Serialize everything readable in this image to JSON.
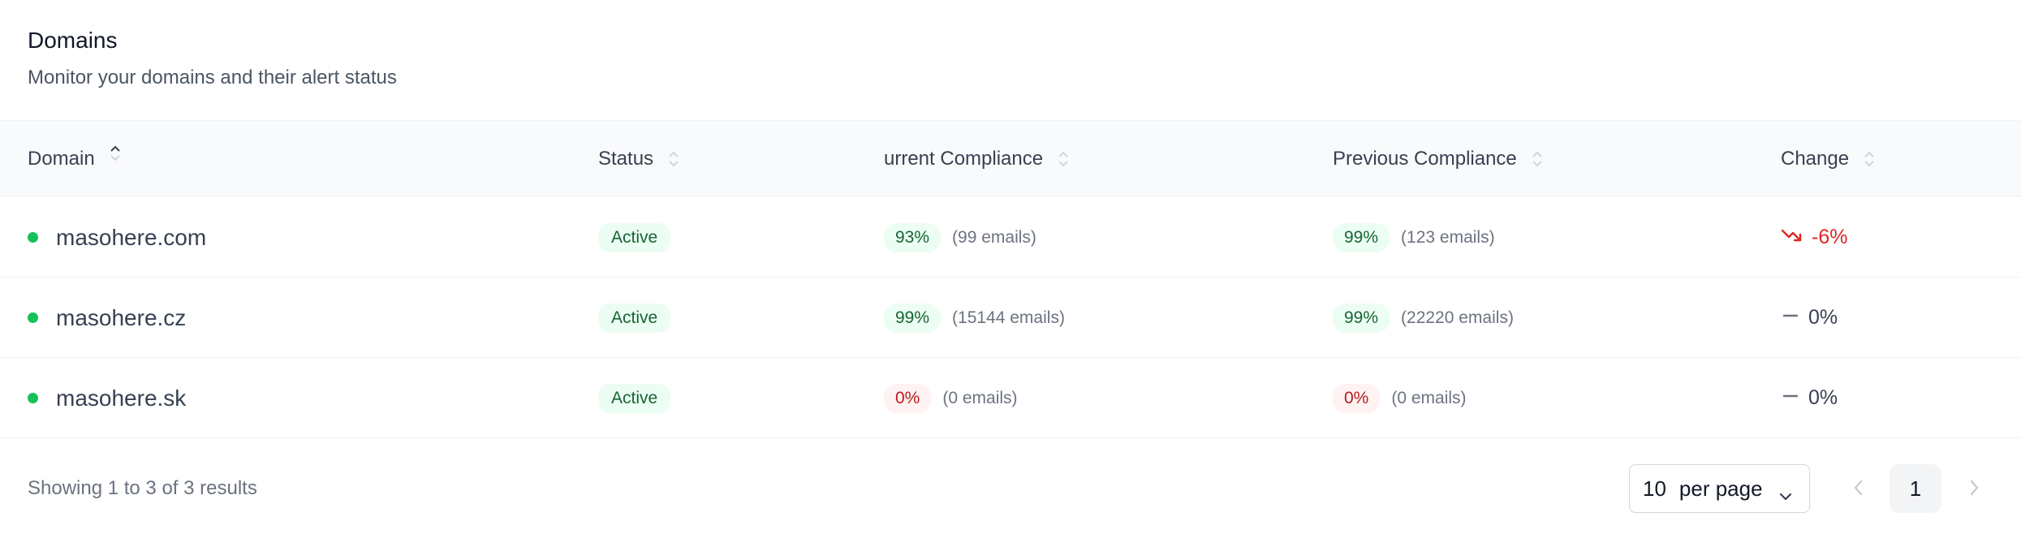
{
  "header": {
    "title": "Domains",
    "subtitle": "Monitor your domains and their alert status"
  },
  "table": {
    "columns": [
      {
        "key": "domain",
        "label": "Domain",
        "sort": "asc"
      },
      {
        "key": "status",
        "label": "Status",
        "sort": "none"
      },
      {
        "key": "current",
        "label": "urrent Compliance",
        "sort": "none"
      },
      {
        "key": "previous",
        "label": "Previous Compliance",
        "sort": "none"
      },
      {
        "key": "change",
        "label": "Change",
        "sort": "none"
      }
    ],
    "rows": [
      {
        "domain": "masohere.com",
        "status": "Active",
        "current_pct": "93%",
        "current_emails": "(99 emails)",
        "previous_pct": "99%",
        "previous_emails": "(123 emails)",
        "change": "-6%",
        "change_trend": "down"
      },
      {
        "domain": "masohere.cz",
        "status": "Active",
        "current_pct": "99%",
        "current_emails": "(15144 emails)",
        "previous_pct": "99%",
        "previous_emails": "(22220 emails)",
        "change": "0%",
        "change_trend": "flat"
      },
      {
        "domain": "masohere.sk",
        "status": "Active",
        "current_pct": "0%",
        "current_emails": "(0 emails)",
        "previous_pct": "0%",
        "previous_emails": "(0 emails)",
        "change": "0%",
        "change_trend": "flat"
      }
    ]
  },
  "footer": {
    "results_text": "Showing 1 to 3 of 3 results",
    "per_page_value": "10",
    "per_page_label": "per page",
    "current_page": "1"
  },
  "icons": {
    "sort": "sort-icon",
    "status_dot": "status-dot-icon",
    "trend_down": "trend-down-icon",
    "trend_flat": "dash-icon",
    "chevron_down": "chevron-down-icon",
    "prev": "chevron-left-icon",
    "next": "chevron-right-icon"
  },
  "colors": {
    "active_dot": "#16c15a",
    "good_badge_bg": "#ecfdf3",
    "good_badge_text": "#166534",
    "bad_badge_bg": "#fef2f2",
    "bad_badge_text": "#b91c1c",
    "negative_change": "#dc2626"
  }
}
